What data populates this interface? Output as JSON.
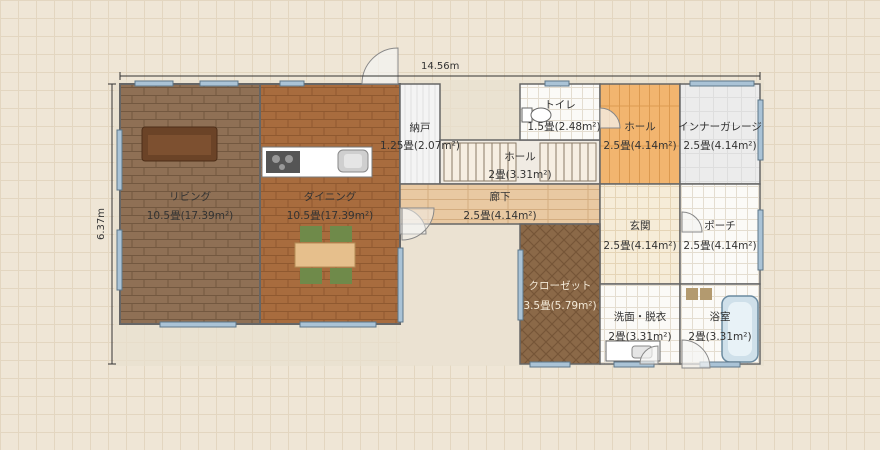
{
  "dimensions": {
    "width_label": "14.56m",
    "height_label": "6.37m"
  },
  "rooms": {
    "living": {
      "name": "リビング",
      "area": "10.5畳(17.39m²)"
    },
    "dining": {
      "name": "ダイニング",
      "area": "10.5畳(17.39m²)"
    },
    "storage": {
      "name": "納戸",
      "area": "1.25畳(2.07m²)"
    },
    "hall_stairs": {
      "name": "ホール",
      "area": "2畳(3.31m²)"
    },
    "toilet": {
      "name": "トイレ",
      "area": "1.5畳(2.48m²)"
    },
    "hall_east": {
      "name": "ホール",
      "area": "2.5畳(4.14m²)"
    },
    "garage": {
      "name": "インナーガレージ",
      "area": "2.5畳(4.14m²)"
    },
    "corridor": {
      "name": "廊下",
      "area": "2.5畳(4.14m²)"
    },
    "entrance": {
      "name": "玄関",
      "area": "2.5畳(4.14m²)"
    },
    "porch": {
      "name": "ポーチ",
      "area": "2.5畳(4.14m²)"
    },
    "closet": {
      "name": "クローゼット",
      "area": "3.5畳(5.79m²)"
    },
    "washroom": {
      "name": "洗面・脱衣",
      "area": "2畳(3.31m²)"
    },
    "bath": {
      "name": "浴室",
      "area": "2畳(3.31m²)"
    }
  }
}
